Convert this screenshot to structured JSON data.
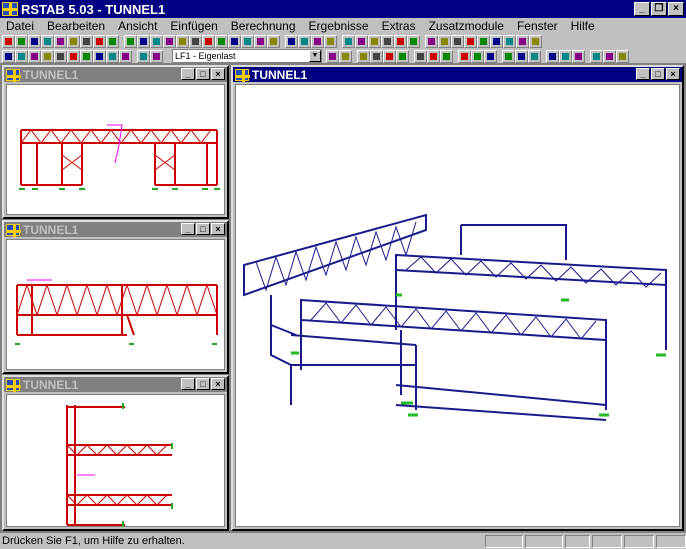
{
  "app": {
    "title": "RSTAB 5.03 - TUNNEL1"
  },
  "menu": [
    "Datei",
    "Bearbeiten",
    "Ansicht",
    "Einfügen",
    "Berechnung",
    "Ergebnisse",
    "Extras",
    "Zusatzmodule",
    "Fenster",
    "Hilfe"
  ],
  "toolbar": {
    "loadcase": "LF1 - Eigenlast",
    "row1_groups": [
      9,
      12,
      4,
      6,
      9
    ],
    "row2_groups": [
      10,
      2
    ],
    "row2_after": [
      2,
      4,
      3,
      3,
      3,
      3,
      3
    ]
  },
  "windows": {
    "view1": "TUNNEL1",
    "view2": "TUNNEL1",
    "view3": "TUNNEL1",
    "main": "TUNNEL1"
  },
  "window_buttons": {
    "min": "_",
    "max": "□",
    "close": "×",
    "restore": "❐"
  },
  "status": {
    "message": "Drücken Sie F1, um Hilfe zu erhalten.",
    "cells": 6
  },
  "colors": {
    "title": "#000080",
    "members": "#cc0000",
    "model3d": "#1a1a8c",
    "support": "#22bb22",
    "load": "#ff00ff"
  }
}
